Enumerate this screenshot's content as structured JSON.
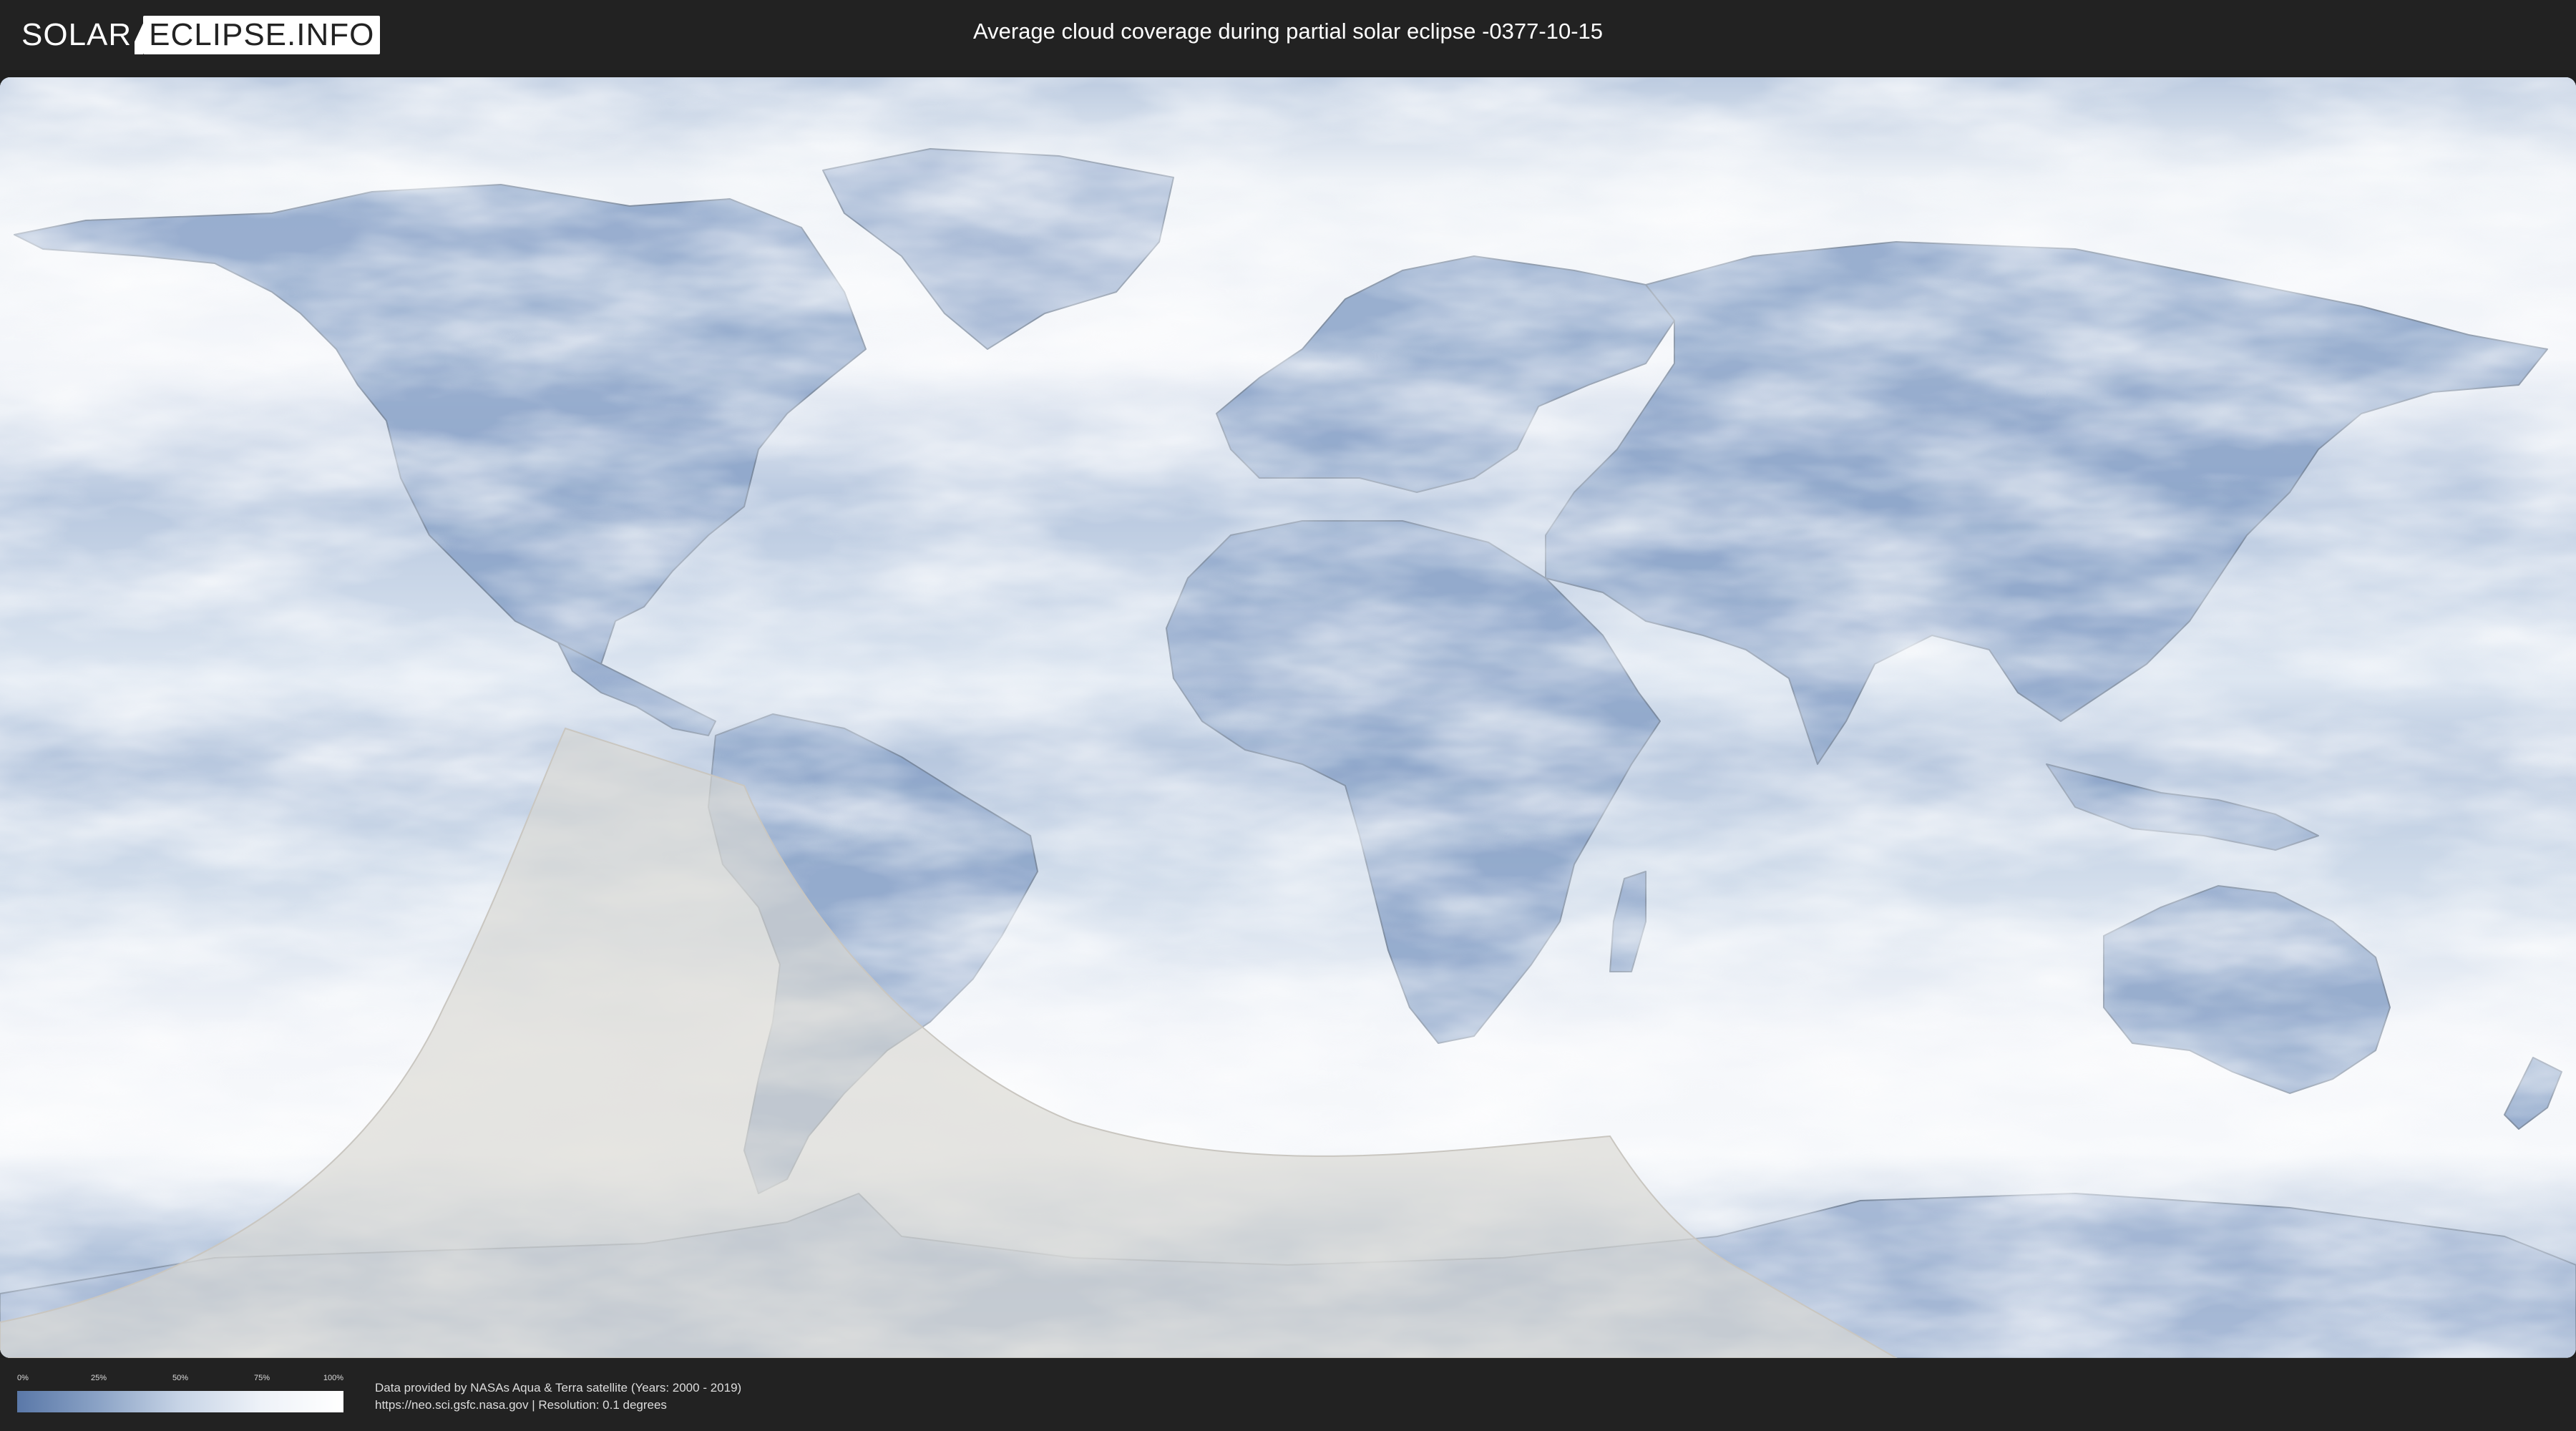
{
  "header": {
    "logo": {
      "part1": "SOLAR",
      "part2": "ECLIPSE.INFO"
    },
    "title": "Average cloud coverage during partial solar eclipse -0377-10-15"
  },
  "map": {
    "colors": {
      "clear_sky": "#5a78a8",
      "cloud": "#ffffff",
      "eclipse_overlay": "#d9d6d0",
      "coastline": "#6f7f95"
    }
  },
  "legend": {
    "ticks": [
      "0%",
      "25%",
      "50%",
      "75%",
      "100%"
    ]
  },
  "credits": {
    "line1": "Data provided by NASAs Aqua & Terra satellite (Years: 2000 - 2019)",
    "line2": "https://neo.sci.gsfc.nasa.gov | Resolution: 0.1 degrees"
  }
}
